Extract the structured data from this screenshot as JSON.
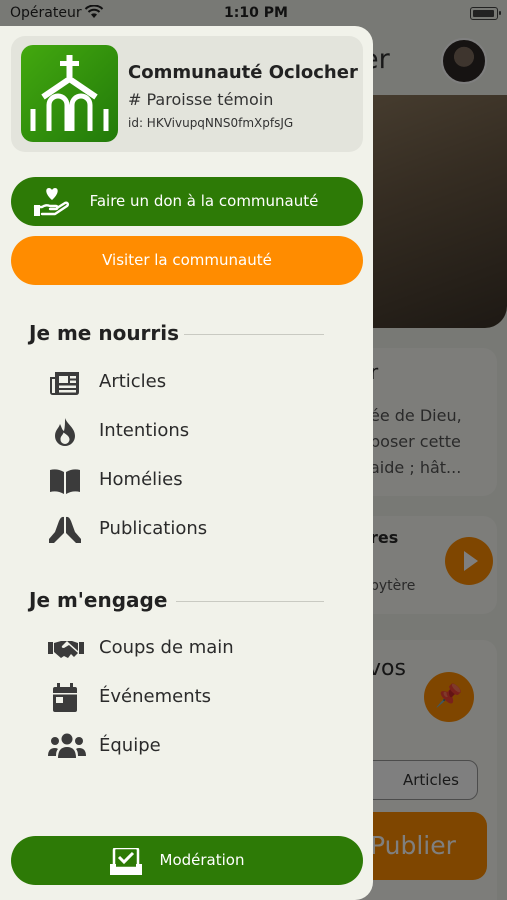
{
  "status_bar": {
    "carrier": "Opérateur",
    "time": "1:10 PM"
  },
  "background": {
    "header_title_fragment": "er",
    "card_title_fragment": "r",
    "card_text": [
      "ée de Dieu,",
      "poser cette",
      "aide ; hât..."
    ],
    "audio_title_fragment": "res",
    "audio_subtitle_fragment": "bytère",
    "post_prompt_fragment": "vos",
    "articles_chip": "Articles",
    "publish_button": "Publier"
  },
  "community": {
    "name": "Communauté Oclocher",
    "type": "# Paroisse témoin",
    "id": "id: HKVivupqNNS0fmXpfsJG"
  },
  "actions": {
    "donate_label": "Faire un don à la communauté",
    "visit_label": "Visiter la communauté",
    "moderation_label": "Modération"
  },
  "sections": [
    {
      "title": "Je me nourris",
      "items": [
        {
          "label": "Articles",
          "icon": "newspaper-icon"
        },
        {
          "label": "Intentions",
          "icon": "flame-icon"
        },
        {
          "label": "Homélies",
          "icon": "book-icon"
        },
        {
          "label": "Publications",
          "icon": "praying-hands-icon"
        }
      ]
    },
    {
      "title": "Je m'engage",
      "items": [
        {
          "label": "Coups de main",
          "icon": "handshake-icon"
        },
        {
          "label": "Événements",
          "icon": "calendar-icon"
        },
        {
          "label": "Équipe",
          "icon": "team-icon"
        }
      ]
    }
  ],
  "colors": {
    "primary_green": "#2d7a06",
    "accent_orange": "#ff8c00",
    "drawer_bg": "#f1f2ea"
  }
}
